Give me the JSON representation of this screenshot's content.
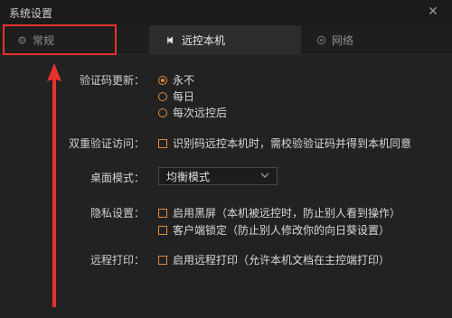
{
  "window": {
    "title": "系统设置",
    "close_glyph": "✕"
  },
  "tabs": [
    {
      "label": "常规",
      "icon": "gear-icon",
      "active": false
    },
    {
      "label": "远控本机",
      "icon": "remote-icon",
      "active": true
    },
    {
      "label": "网络",
      "icon": "globe-icon",
      "active": false
    }
  ],
  "settings": {
    "captcha_update": {
      "label": "验证码更新：",
      "options": [
        "永不",
        "每日",
        "每次远控后"
      ],
      "selected": "永不"
    },
    "two_step": {
      "label": "双重验证访问：",
      "option": "识别码远控本机时，需校验验证码并得到本机同意",
      "checked": false
    },
    "desktop_mode": {
      "label": "桌面模式：",
      "value": "均衡模式"
    },
    "privacy": {
      "label": "隐私设置：",
      "options": [
        "启用黑屏（本机被远控时，防止别人看到操作）",
        "客户端锁定（防止别人修改你的向日葵设置）"
      ]
    },
    "remote_print": {
      "label": "远程打印：",
      "option": "启用远程打印（允许本机文档在主控端打印）",
      "checked": false
    }
  },
  "colors": {
    "accent": "#e58a3a",
    "annotation": "#e8322d",
    "background": "#222222"
  }
}
